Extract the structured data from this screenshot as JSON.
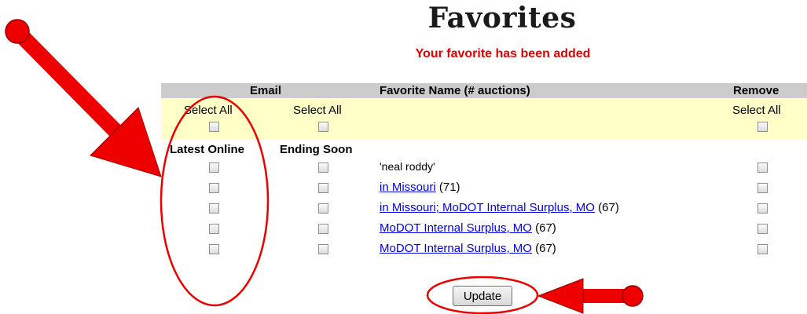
{
  "page": {
    "title": "Favorites",
    "message": "Your favorite has been added",
    "message_color": "#e00000"
  },
  "table": {
    "headers": {
      "email": "Email",
      "favorite": "Favorite Name (# auctions)",
      "remove": "Remove"
    },
    "select_all": "Select All",
    "subheaders": {
      "latest": "Latest Online",
      "ending": "Ending Soon"
    },
    "rows": [
      {
        "prefix": "'neal roddy'",
        "link": "",
        "count": ""
      },
      {
        "prefix": "",
        "link": "in Missouri",
        "count": "(71)"
      },
      {
        "prefix": "",
        "link": "in Missouri; MoDOT Internal Surplus, MO",
        "count": "(67)"
      },
      {
        "prefix": "",
        "link": "MoDOT Internal Surplus, MO",
        "count": "(67)"
      },
      {
        "prefix": "",
        "link": "MoDOT Internal Surplus, MO",
        "count": "(67)"
      }
    ]
  },
  "update_button": "Update",
  "annotation_color": "#ee0000",
  "header_bg": "#cccccc",
  "select_bg": "#ffffc8"
}
